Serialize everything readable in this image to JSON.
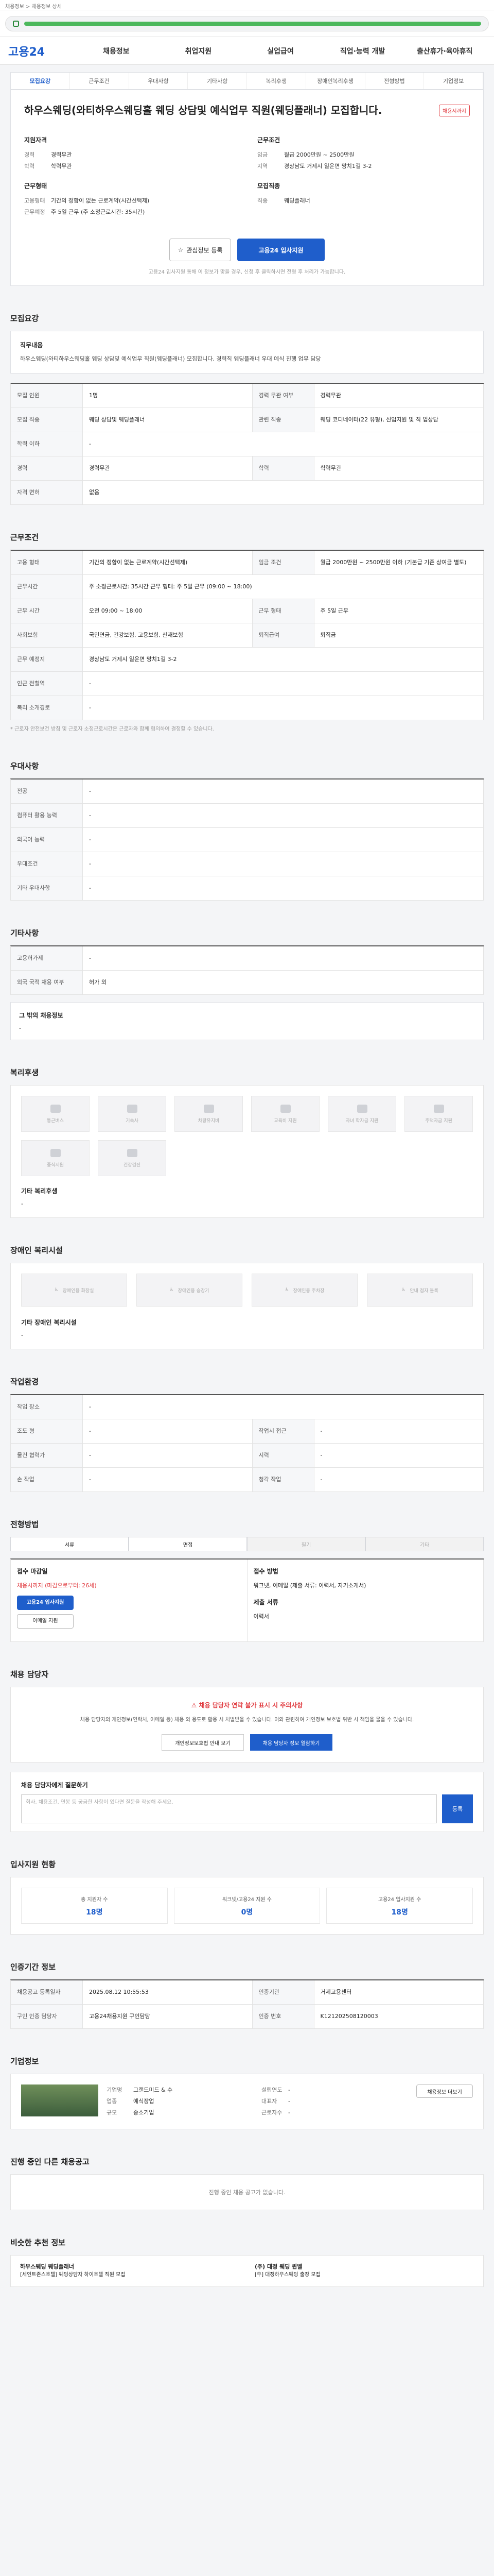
{
  "topbar": {
    "text": "채용정보 > 채용정보 상세"
  },
  "gnb": {
    "logo": "고용24",
    "items": [
      "채용정보",
      "취업지원",
      "실업급여",
      "직업·능력 개발",
      "출산휴가·육아휴직"
    ]
  },
  "subtabs": [
    "모집요강",
    "근무조건",
    "우대사항",
    "기타사항",
    "복리후생",
    "장애인복리후생",
    "전형방법",
    "기업정보"
  ],
  "header": {
    "title": "하우스웨딩(와티하우스웨딩홀 웨딩 상담및 예식업무 직원(웨딩플래너) 모집합니다.",
    "dday": "채용시까지",
    "left_h": "지원자격",
    "left": [
      [
        "경력",
        "경력무관"
      ],
      [
        "학력",
        "학력무관"
      ]
    ],
    "left_h2": "근무형태",
    "left2": [
      [
        "고용형태",
        "기간의 정함이 없는 근로계약(시간선택제)"
      ],
      [
        "근무예정",
        "주 5일 근무 (주 소정근로시간: 35시간)"
      ]
    ],
    "right_h": "근무조건",
    "right": [
      [
        "임금",
        "월급 2000만원 ~ 2500만원"
      ],
      [
        "지역",
        "경상남도 거제시 일운면 망치1길 3-2"
      ]
    ],
    "right_h2": "모집직종",
    "right2": [
      [
        "직종",
        "웨딩플래너"
      ]
    ],
    "btn_save": "관심정보 등록",
    "btn_apply": "고용24 입사지원",
    "note": "고용24 입사지원 통해 이 정보가 맞을 경우, 신청 후 클릭하시면 전형 후 처리가 가능합니다."
  },
  "recruit": {
    "title": "모집요강",
    "desc_label": "직무내용",
    "desc": "하우스웨딩(와티하우스웨딩홀 웨딩 상담및 예식업무 직원(웨딩플래너) 모집합니다. 경력직 웨딩플래너 우대 예식 진행 업무 담당",
    "rows": [
      [
        "모집 인원",
        "1명",
        "경력 무관 여부",
        "경력무관"
      ],
      [
        "모집 직종",
        "웨딩 상담및 웨딩플래너",
        "관련 직종",
        "웨딩 코디네이터(22 유형), 신입지원 및 직 업상담"
      ],
      [
        "학력 이하",
        "-",
        "",
        ""
      ],
      [
        "경력",
        "경력무관",
        "학력",
        "학력무관"
      ],
      [
        "자격 면허",
        "없음",
        "",
        ""
      ]
    ]
  },
  "work": {
    "title": "근무조건",
    "rows": [
      [
        "고용 형태",
        "기간의 정함이 없는 근로계약(시간선택제)",
        "임금 조건",
        "월급 2000만원 ~ 2500만원 이하 (기본급 기준 상여금 별도)"
      ],
      [
        "근무시간",
        "주 소정근로시간: 35시간 근무 형태: 주 5일 근무 (09:00 ~ 18:00)",
        "",
        ""
      ],
      [
        "근무 시간",
        "오전 09:00 ~ 18:00",
        "근무 형태",
        "주 5일 근무"
      ],
      [
        "사회보험",
        "국민연금, 건강보험, 고용보험, 산재보험",
        "퇴직급여",
        "퇴직금"
      ],
      [
        "근무 예정지",
        "경상남도 거제시 일운면 망치1길 3-2",
        "",
        ""
      ],
      [
        "인근 전철역",
        "-",
        "",
        ""
      ],
      [
        "복리 소개경로",
        "-",
        "",
        ""
      ]
    ],
    "note": "* 근로자 안전보건 방침 및 근로자 소정근로시간은 근로자와 함께 협의하여 결정할 수 있습니다."
  },
  "prefer": {
    "title": "우대사항",
    "rows": [
      [
        "전공",
        "-"
      ],
      [
        "컴퓨터 활용 능력",
        "-"
      ],
      [
        "외국어 능력",
        "-"
      ],
      [
        "우대조건",
        "-"
      ],
      [
        "기타 우대사항",
        "-"
      ]
    ]
  },
  "other": {
    "title": "기타사항",
    "rows": [
      [
        "고용허가제",
        "-"
      ],
      [
        "외국 국적 채용 여부",
        "허가 외"
      ]
    ],
    "extra_label": "그 밖의 채용정보",
    "extra": "-"
  },
  "welfare": {
    "title": "복리후생",
    "items": [
      "통근버스",
      "기숙사",
      "차량유지비",
      "교육비 지원",
      "자녀 학자금 지원",
      "주택자금 지원",
      "중식지원",
      "건강검진"
    ],
    "extra_label": "기타 복리후생",
    "extra": "-"
  },
  "disability": {
    "title": "장애인 복리시설",
    "items": [
      "장애인용 화장실",
      "장애인용 승강기",
      "장애인용 주차장",
      "안내 점자 블록"
    ],
    "extra_label": "기타 장애인 복리시설",
    "extra": "-"
  },
  "process": {
    "title": "작업환경",
    "rows": [
      [
        "작업 장소",
        "-",
        "",
        ""
      ],
      [
        "조도 형",
        "-",
        "작업시 접근",
        "-"
      ],
      [
        "물건 협력가",
        "-",
        "시력",
        "-"
      ],
      [
        "손 작업",
        "-",
        "청각 작업",
        "-"
      ]
    ]
  },
  "selection": {
    "title": "전형방법",
    "steps": [
      "서류",
      "면접",
      "필기",
      "기타"
    ],
    "left_h": "접수 마감일",
    "deadline": "채용시까지 (마감으로부터: 26세)",
    "apply_btn": "고용24 입사지원",
    "email_btn": "이메일 지원",
    "right_h": "접수 방법",
    "right": "워크넷, 이메일 (제출 서류: 이력서, 자기소개서)",
    "doc_h": "제출 서류",
    "doc": "이력서"
  },
  "contact": {
    "title": "채용 담당자",
    "alert": "채용 담당자 연락 불가 표시 시 주의사항",
    "text": "채용 담당자의 개인정보(연락처, 이메일 등) 채용 외 용도로 활용 시 처벌받을 수 있습니다. 이와 관련하여 개인정보 보호법 위반 시 책임을 물을 수 있습니다.",
    "btn1": "개인정보보호법 안내 보기",
    "btn2": "채용 담당자 정보 열람하기"
  },
  "question": {
    "title": "채용 담당자에게 질문하기",
    "placeholder": "회사, 채용조건, 연봉 등 궁금한 사항이 있다면 질문을 작성해 주세요.",
    "btn": "등록"
  },
  "stats": {
    "title": "입사지원 현황",
    "items": [
      [
        "총 지원자 수",
        "18명"
      ],
      [
        "워크넷/고용24 지원 수",
        "0명"
      ],
      [
        "고용24 입사지원 수",
        "18명"
      ]
    ]
  },
  "period": {
    "title": "인증기간 정보",
    "rows": [
      [
        "채용공고 등록일자",
        "2025.08.12 10:55:53",
        "인증기관",
        "거제고용센터"
      ],
      [
        "구인 인증 담당자",
        "고용24채용지원 구인담당",
        "인증 번호",
        "K121202508120003"
      ]
    ]
  },
  "company": {
    "title": "기업정보",
    "rows": [
      [
        "기업명",
        "그랜드미드 & 수"
      ],
      [
        "업종",
        "예식장업"
      ],
      [
        "규모",
        "중소기업"
      ],
      [
        "설립연도",
        "-"
      ],
      [
        "대표자",
        "-"
      ],
      [
        "근로자수",
        "-"
      ]
    ],
    "btn": "채용정보 더보기"
  },
  "more": {
    "title": "진행 중인 다른 채용공고",
    "empty": "진행 중인 채용 공고가 없습니다."
  },
  "similar": {
    "title": "비슷한 추천 정보",
    "items": [
      [
        "하우스웨딩 웨딩플래너",
        "[세인트존스호텔] 웨딩상담자 하이호텔 직원 모집"
      ],
      [
        "(주) 대정 웨딩 퀸벨",
        "[우] 대정하우스웨딩 출장 모집"
      ]
    ]
  }
}
